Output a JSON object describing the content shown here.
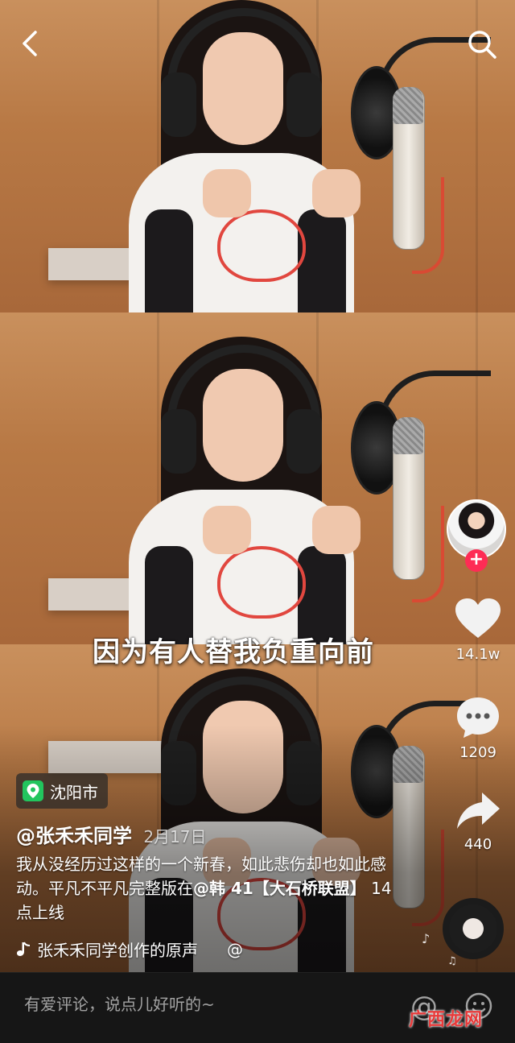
{
  "video": {
    "subtitle": "因为有人替我负重向前"
  },
  "top_bar": {
    "back_icon": "back-chevron-icon",
    "search_icon": "search-icon"
  },
  "rail": {
    "like_count": "14.1w",
    "comment_count": "1209",
    "share_count": "440",
    "follow_symbol": "+"
  },
  "post": {
    "location": "沈阳市",
    "author": "@张禾禾同学",
    "date": "2月17日",
    "description_part1": "我从没经历过这样的一个新春，如此悲伤却也如此感动。平凡不平凡完整版在",
    "mention": "@韩 41【大石桥联盟】",
    "description_part2": "14点上线",
    "sound": "张禾禾同学创作的原声",
    "sound_suffix": "@"
  },
  "comment_bar": {
    "placeholder": "有爱评论，说点儿好听的~",
    "at_symbol": "@"
  },
  "watermark": "广西龙网",
  "colors": {
    "follow_badge": "#fe2c55",
    "location_pin": "#22c55e",
    "watermark": "#e73a3a"
  }
}
